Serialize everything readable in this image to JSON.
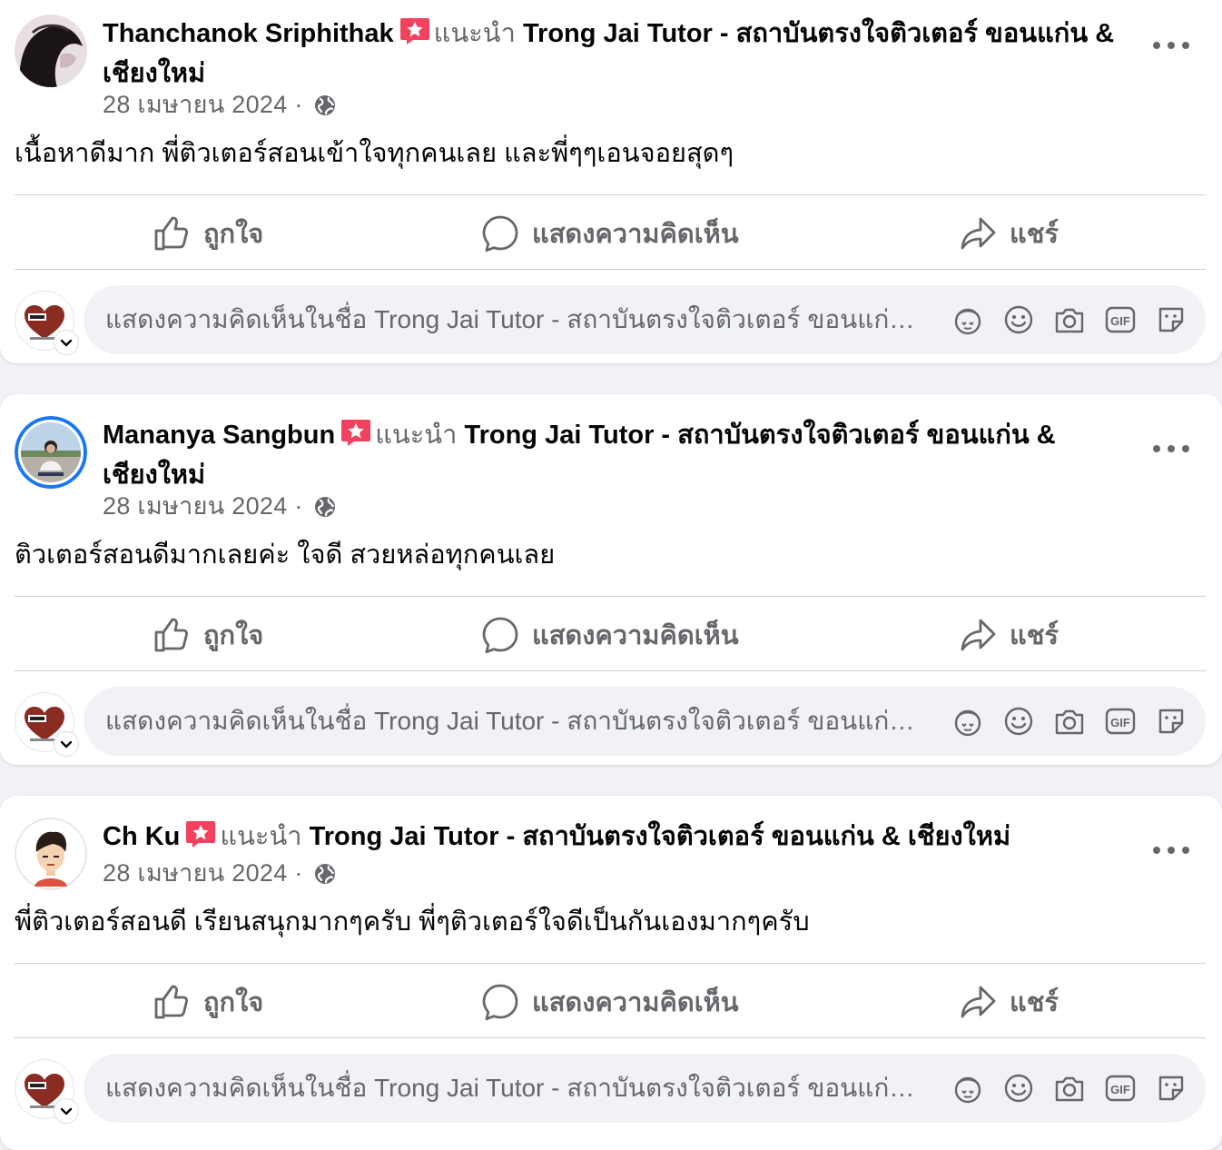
{
  "posts": [
    {
      "author": "Thanchanok Sriphithak",
      "recommends": "แนะนำ",
      "page": "Trong Jai Tutor - สถาบันตรงใจติวเตอร์ ขอนแก่น & เชียงใหม่",
      "date": "28 เมษายน 2024",
      "dot": "·",
      "text": "เนื้อหาดีมาก พี่ติวเตอร์สอนเข้าใจทุกคนเลย และพี่ๆๆเอนจอยสุดๆ",
      "avatar_icon": "profile-photo"
    },
    {
      "author": "Mananya Sangbun",
      "recommends": "แนะนำ",
      "page": "Trong Jai Tutor - สถาบันตรงใจติวเตอร์ ขอนแก่น & เชียงใหม่",
      "date": "28 เมษายน 2024",
      "dot": "·",
      "text": "ติวเตอร์สอนดีมากเลยค่ะ ใจดี สวยหล่อทุกคนเลย",
      "avatar_icon": "profile-photo-with-story-ring"
    },
    {
      "author": "Ch Ku",
      "recommends": "แนะนำ",
      "page": "Trong Jai Tutor - สถาบันตรงใจติวเตอร์ ขอนแก่น & เชียงใหม่",
      "date": "28 เมษายน 2024",
      "dot": "·",
      "text": "พี่ติวเตอร์สอนดี เรียนสนุกมากๆครับ พี่ๆติวเตอร์ใจดีเป็นกันเองมากๆครับ",
      "avatar_icon": "cartoon-avatar"
    }
  ],
  "actions": {
    "like": "ถูกใจ",
    "comment": "แสดงความคิดเห็น",
    "share": "แชร์"
  },
  "comment_box": {
    "placeholder": "แสดงความคิดเห็นในชื่อ Trong Jai Tutor - สถาบันตรงใจติวเตอร์ ขอนแก่น & เชียงใหม่"
  },
  "icons": {
    "badge": "recommend-star-icon",
    "privacy": "globe-icon",
    "comment_tools": [
      "avatar-sticker-icon",
      "emoji-icon",
      "camera-icon",
      "gif-icon",
      "sticker-icon"
    ]
  },
  "colors": {
    "background": "#f0f2f5",
    "card": "#ffffff",
    "secondary_text": "#65676b",
    "badge_red": "#f3425f",
    "story_ring": "#1877f2"
  }
}
